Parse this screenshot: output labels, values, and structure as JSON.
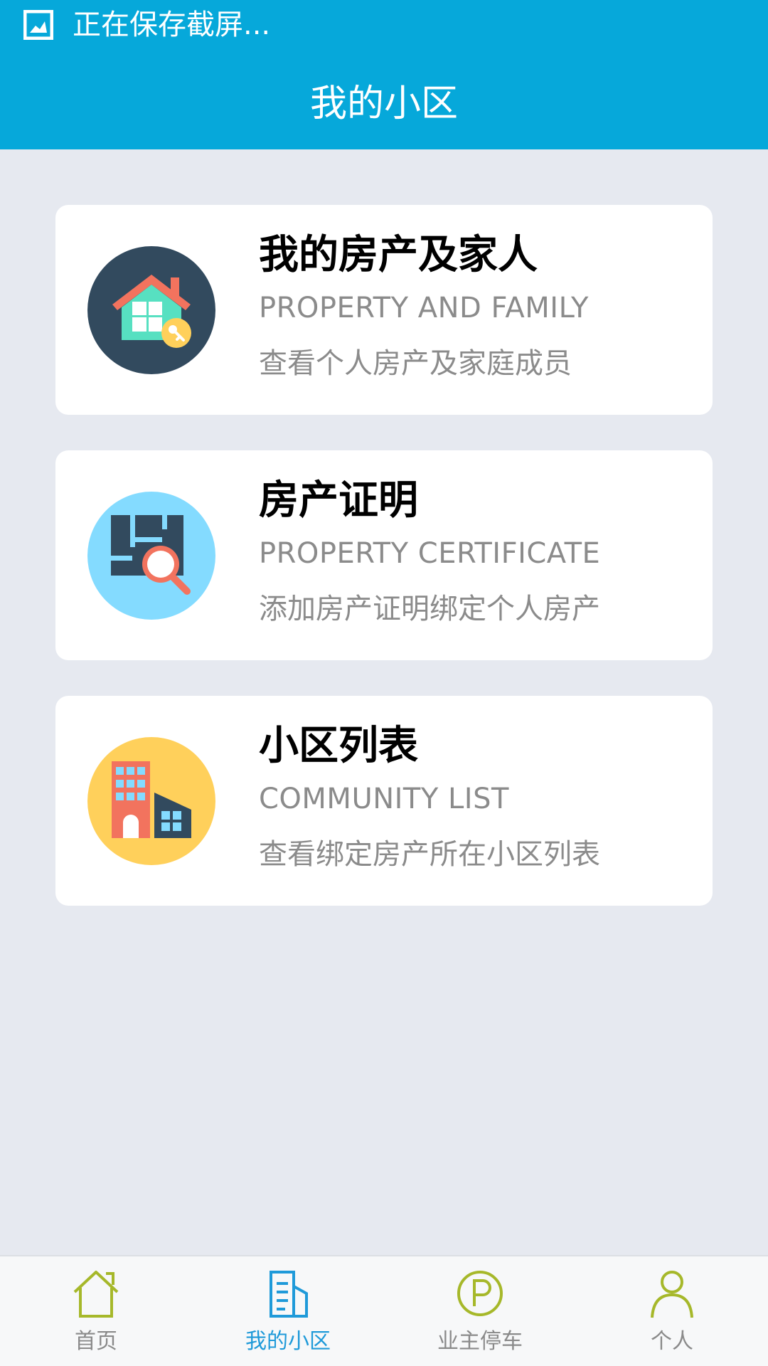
{
  "status_bar": {
    "notice": "正在保存截屏..."
  },
  "header": {
    "title": "我的小区"
  },
  "cards": [
    {
      "title": "我的房产及家人",
      "subtitle": "PROPERTY AND FAMILY",
      "description": "查看个人房产及家庭成员",
      "icon": "house-key-icon"
    },
    {
      "title": "房产证明",
      "subtitle": "PROPERTY CERTIFICATE",
      "description": "添加房产证明绑定个人房产",
      "icon": "floorplan-search-icon"
    },
    {
      "title": "小区列表",
      "subtitle": "COMMUNITY LIST",
      "description": "查看绑定房产所在小区列表",
      "icon": "buildings-icon"
    }
  ],
  "bottom_nav": {
    "items": [
      {
        "label": "首页",
        "icon": "home-icon",
        "active": false
      },
      {
        "label": "我的小区",
        "icon": "document-building-icon",
        "active": true
      },
      {
        "label": "业主停车",
        "icon": "parking-icon",
        "active": false
      },
      {
        "label": "个人",
        "icon": "person-icon",
        "active": false
      }
    ]
  },
  "colors": {
    "header": "#06a8da",
    "background": "#e6e9f0",
    "nav_active": "#1f9ad9",
    "nav_inactive_icon": "#a6b82a"
  }
}
